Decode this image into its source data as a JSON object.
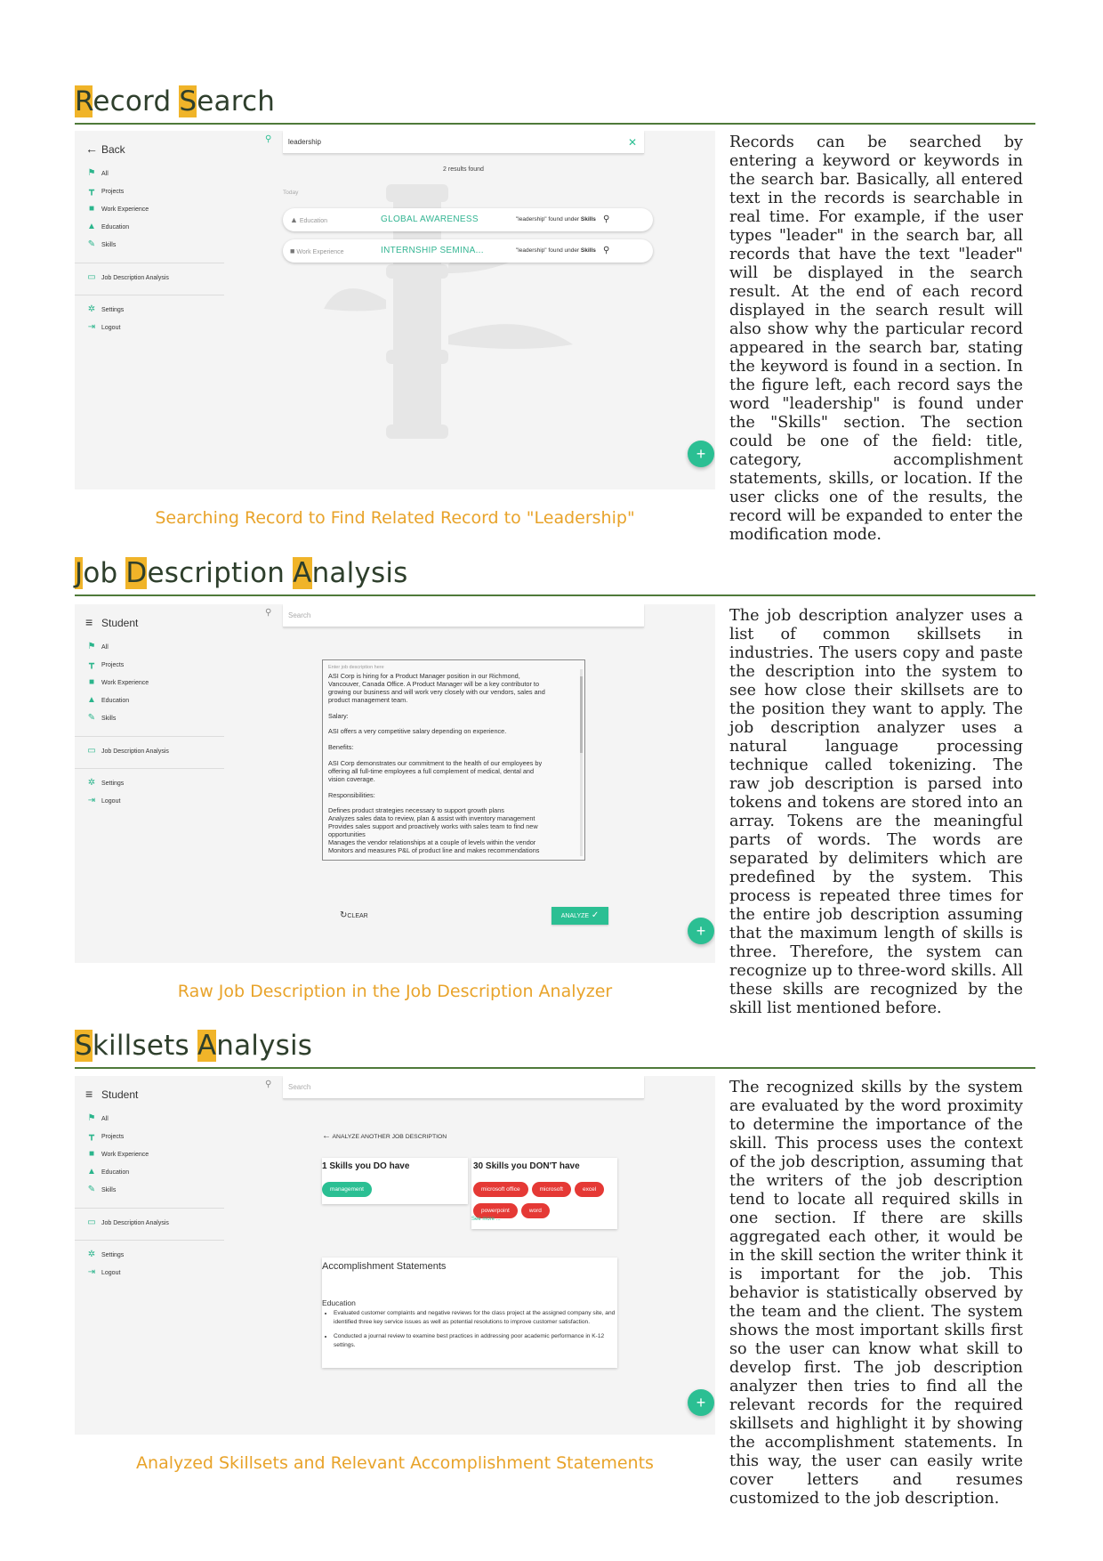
{
  "sections": [
    {
      "title_words": [
        {
          "hl": "R",
          "rest": "ecord"
        },
        {
          "hl": "S",
          "rest": "earch"
        }
      ],
      "caption": "Searching Record to Find Related Record to \"Leadership\"",
      "paragraph": "Records can be searched by entering a keyword or keywords in the search bar. Basically, all entered text in the records is searchable in real time. For example, if the user types \"leader\" in the search bar, all records that have the text \"leader\" will be displayed in the search result. At the end of each record displayed in the search result will also show why the particular record appeared in the search bar, stating the keyword is found in a section. In the figure left, each record says the word \"leadership\" is found under the \"Skills\" section. The section could be one of the field: title, category, accomplishment statements, skills, or location. If the user clicks one of the results, the record will be expanded to enter the modification mode."
    },
    {
      "title_words": [
        {
          "hl": "J",
          "rest": "ob"
        },
        {
          "hl": "D",
          "rest": "escription"
        },
        {
          "hl": "A",
          "rest": "nalysis"
        }
      ],
      "caption": "Raw Job Description in the Job Description Analyzer",
      "paragraph": "The job description analyzer uses a list of common skillsets in industries. The users copy and paste the description into the system to see how close their skillsets are to the position they want to apply. The job description analyzer uses a natural language processing technique called tokenizing. The raw job description is parsed into tokens and tokens are stored into an array. Tokens are the meaningful parts of words. The words are separated by delimiters which are predefined by the system. This process is repeated three times for the entire job description assuming that the maximum length of skills is three. Therefore, the system can recognize up to three-word skills. All these skills are recognized by the skill list mentioned before."
    },
    {
      "title_words": [
        {
          "hl": "S",
          "rest": "killsets"
        },
        {
          "hl": "A",
          "rest": "nalysis"
        }
      ],
      "caption": "Analyzed Skillsets and Relevant Accomplishment Statements",
      "paragraph": "The recognized skills by the system are evaluated by the word proximity to determine the importance of the skill. This process uses the context of the job description, assuming that the writers of the job description tend to locate all required skills in one section. If there are skills aggregated each other, it would be in the skill section the writer think it is important for the job. This behavior is statistically observed by the team and the client. The system shows the most important skills first so the user can know what skill to develop first. The job description analyzer then tries to find all the relevant records for the required skillsets and highlight it by showing the accomplishment statements. In this way, the user can easily write cover letters and resumes customized to the job description."
    }
  ],
  "sidebar": {
    "back_label": "Back",
    "student_label": "Student",
    "items": [
      "All",
      "Projects",
      "Work Experience",
      "Education",
      "Skills"
    ],
    "analysis_label": "Job Description Analysis",
    "settings_label": "Settings",
    "logout_label": "Logout"
  },
  "search_screen": {
    "query": "leadership",
    "results_count": "2 results found",
    "group_label": "Today",
    "results": [
      {
        "category": "Education",
        "title": "GLOBAL AWARENESS",
        "reason_prefix": "\"leadership\" found under ",
        "reason_section": "Skills"
      },
      {
        "category": "Work Experience",
        "title": "INTERNSHIP SEMINA...",
        "reason_prefix": "\"leadership\" found under ",
        "reason_section": "Skills"
      }
    ]
  },
  "analyzer_screen": {
    "search_placeholder": "Search",
    "jd_placeholder": "Enter job description here",
    "jd_text": "ASI Corp is hiring for a Product Manager position in our Richmond,\nVancouver, Canada Office. A Product Manager will be a key contributor to\ngrowing our business and will work very closely with our vendors, sales and\nproduct management team.\n\nSalary:\n\nASI offers a very competitive salary depending on experience.\n\nBenefits:\n\nASI Corp demonstrates our commitment to the health of our employees by\noffering all full-time employees a full complement of medical, dental and\nvision coverage.\n\nResponsibilities:\n\nDefines product strategies necessary to support growth plans\nAnalyzes sales data to review, plan & assist with inventory management\nProvides sales support and proactively works with sales team to find new\nopportunities\nManages the vendor relationships at a couple of levels within the vendor\nMonitors and measures P&L of product line and makes recommendations",
    "clear_label": "CLEAR",
    "analyze_label": "ANALYZE"
  },
  "skills_screen": {
    "search_placeholder": "Search",
    "back_link": "ANALYZE ANOTHER JOB DESCRIPTION",
    "have_title": "1 Skills you DO have",
    "have_chips": [
      "management"
    ],
    "missing_title": "30 Skills you DON'T have",
    "missing_chips": [
      "microsoft office",
      "microsoft",
      "excel",
      "powerpoint",
      "word"
    ],
    "see_more": "See more ...",
    "acc_title": "Accomplishment Statements",
    "acc_section": "Education",
    "acc_items": [
      "Evaluated customer complaints and negative reviews for the class project at the assigned company site, and identified three key service issues as well as potential resolutions to improve customer satisfaction.",
      "Conducted a journal review to examine best practices in addressing poor academic performance in K-12 settings."
    ]
  },
  "icons": {
    "back": "arrow-left-icon",
    "menu": "hamburger-icon",
    "search": "search-icon",
    "clear": "close-icon",
    "all": "flag-icon",
    "projects": "paint-roller-icon",
    "work": "briefcase-icon",
    "education": "graduation-cap-icon",
    "skills": "wrench-icon",
    "analysis": "card-icon",
    "settings": "gear-icon",
    "logout": "exit-icon",
    "fab": "plus-icon",
    "refresh": "refresh-icon",
    "check": "check-icon"
  },
  "colors": {
    "accent": "#2bbf93",
    "caption": "#e8a32a",
    "highlight": "#f0b429",
    "rule": "#4f7a3a",
    "chip_red": "#e53935"
  }
}
